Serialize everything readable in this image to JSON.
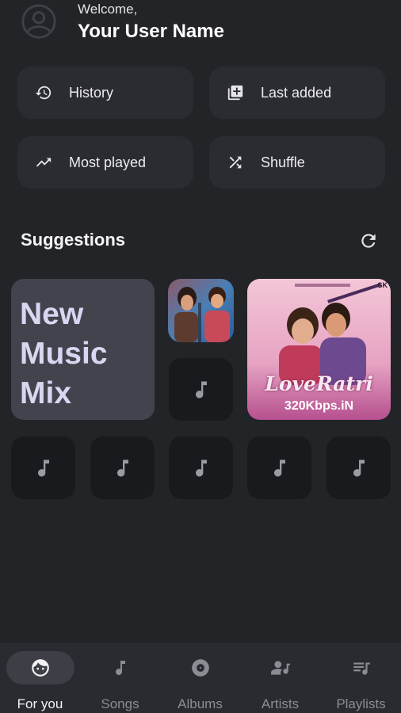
{
  "header": {
    "welcome": "Welcome,",
    "username": "Your User Name",
    "avatar_icon": "account-circle-icon"
  },
  "quick_actions": [
    {
      "label": "History",
      "icon": "history-icon"
    },
    {
      "label": "Last added",
      "icon": "library-add-icon"
    },
    {
      "label": "Most played",
      "icon": "trending-up-icon"
    },
    {
      "label": "Shuffle",
      "icon": "shuffle-icon"
    }
  ],
  "suggestions": {
    "title": "Suggestions",
    "refresh_icon": "refresh-icon",
    "mix_card": {
      "line1": "New",
      "line2": "Music",
      "line3": "Mix"
    },
    "album_art_2": {
      "title": "LoveRatri",
      "watermark": "320Kbps.iN",
      "tag": "SK"
    }
  },
  "bottom_nav": {
    "items": [
      {
        "label": "For you",
        "icon": "face-icon",
        "active": true
      },
      {
        "label": "Songs",
        "icon": "music-note-icon",
        "active": false
      },
      {
        "label": "Albums",
        "icon": "album-icon",
        "active": false
      },
      {
        "label": "Artists",
        "icon": "artist-icon",
        "active": false
      },
      {
        "label": "Playlists",
        "icon": "playlist-icon",
        "active": false
      }
    ]
  },
  "colors": {
    "background": "#232428",
    "card": "#2b2c31",
    "mix_card": "#43434d",
    "mix_text": "#d9d6f2",
    "nav_bg": "#2a2b30",
    "nav_active_pill": "#3d3e46"
  }
}
